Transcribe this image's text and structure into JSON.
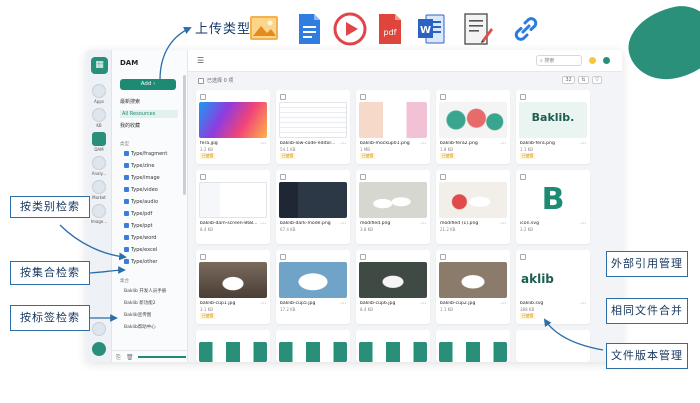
{
  "annotations": {
    "upload_types": "上传类型",
    "by_category": "按类别检索",
    "by_collection": "按集合检索",
    "by_tag": "按标签检索",
    "external_ref": "外部引用管理",
    "merge_files": "相同文件合并",
    "versioning": "文件版本管理"
  },
  "file_type_icons": [
    "image-file-icon",
    "document-file-icon",
    "video-file-icon",
    "pdf-file-icon",
    "word-file-icon",
    "text-file-icon",
    "link-icon"
  ],
  "file_type_labels": {
    "pdf": "pdf",
    "word": "W"
  },
  "rail": {
    "items": [
      {
        "label": "Apps"
      },
      {
        "label": "KB"
      },
      {
        "label": "DAM"
      },
      {
        "label": "Analy..."
      },
      {
        "label": "Market"
      },
      {
        "label": "Image..."
      }
    ]
  },
  "sidebar": {
    "title": "DAM",
    "add_label": "Add",
    "links": [
      "最新搜索",
      "All Resources",
      "我的收藏"
    ],
    "types_head": "类型",
    "types": [
      "Type/fragment",
      "Type/zine",
      "Type/image",
      "Type/video",
      "Type/audio",
      "Type/pdf",
      "Type/ppt",
      "Type/word",
      "Type/excel",
      "Type/other"
    ],
    "collections_head": "集合",
    "collections": [
      "Baklib 开发人员手册",
      "Baklib 新功能2",
      "Baklib宣传图",
      "Baklib帮助中心"
    ]
  },
  "toolbar": {
    "search_placeholder": "搜索",
    "select_all": "已选择 0 项",
    "count": "32"
  },
  "files": [
    {
      "name": "fera.jpg",
      "size": "3.2 KB",
      "tag": "已使用"
    },
    {
      "name": "baklib-low-code-editor...",
      "size": "54.1 KB",
      "tag": "已使用"
    },
    {
      "name": "baklib-mockup01.png",
      "size": "1 MB",
      "tag": "已使用"
    },
    {
      "name": "baklib-fera2.png",
      "size": "1.8 KB",
      "tag": "已使用"
    },
    {
      "name": "baklib-fera.png",
      "size": "1.1 KB",
      "tag": "已使用"
    },
    {
      "name": "baklib-dam-screen-868...",
      "size": "8.4 KB",
      "tag": ""
    },
    {
      "name": "baklib-dark-mode.png",
      "size": "67.4 KB",
      "tag": ""
    },
    {
      "name": "modified.png",
      "size": "3.8 KB",
      "tag": ""
    },
    {
      "name": "modified (1).png",
      "size": "21.2 KB",
      "tag": ""
    },
    {
      "name": "icon.svg",
      "size": "3.2 KB",
      "tag": ""
    },
    {
      "name": "baklib-cup1.jpg",
      "size": "3.1 KB",
      "tag": "已使用"
    },
    {
      "name": "baklib-cup5.jpg",
      "size": "17.2 KB",
      "tag": ""
    },
    {
      "name": "baklib-cup6.jpg",
      "size": "8.4 KB",
      "tag": ""
    },
    {
      "name": "baklib-cup2.jpg",
      "size": "1.1 KB",
      "tag": ""
    },
    {
      "name": "baklib.svg",
      "size": "388 KB",
      "tag": "已使用"
    }
  ],
  "thumb_text": {
    "baklib_logo": "Baklib.",
    "baklib_plain": "aklib",
    "b_letter": "B"
  },
  "colors": {
    "accent": "#1f8a73",
    "annotation_border": "#2e6ea8",
    "annotation_text": "#14355e",
    "tag_text": "#c98a00"
  }
}
